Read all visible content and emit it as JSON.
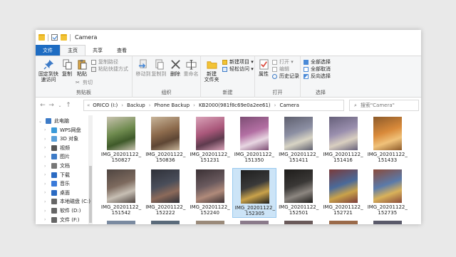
{
  "window": {
    "title": "Camera"
  },
  "tabs": [
    {
      "label": "文件",
      "kind": "file"
    },
    {
      "label": "主页",
      "kind": "active"
    },
    {
      "label": "共享",
      "kind": ""
    },
    {
      "label": "查看",
      "kind": ""
    }
  ],
  "ribbon": {
    "clipboard": {
      "label": "剪贴板",
      "pin": "固定到快\n速访问",
      "copy": "复制",
      "paste": "粘贴",
      "copy_path": "复制路径",
      "paste_shortcut": "粘贴快捷方式",
      "cut": "剪切"
    },
    "organize": {
      "label": "组织",
      "move_to": "移动到",
      "copy_to": "复制到",
      "delete": "删除",
      "rename": "重命名"
    },
    "new": {
      "label": "新建",
      "new_folder": "新建\n文件夹",
      "new_item": "新建项目 ▾",
      "easy_access": "轻松访问 ▾"
    },
    "open": {
      "label": "打开",
      "properties": "属性",
      "open": "打开 ▾",
      "edit": "编辑",
      "history": "历史记录"
    },
    "select": {
      "label": "选择",
      "select_all": "全部选择",
      "select_none": "全部取消",
      "invert": "反向选择"
    }
  },
  "address": {
    "crumbs": [
      "ORICO (I:)",
      "Backup",
      "Phone Backup",
      "KB2000(981f8c69e0a2ee61)",
      "Camera"
    ],
    "search_placeholder": "搜索\"Camera\""
  },
  "sidebar": [
    {
      "label": "此电脑",
      "icon": "pc-icon",
      "indent": 0
    },
    {
      "label": "WPS网盘",
      "icon": "cloud-icon",
      "indent": 1
    },
    {
      "label": "3D 对象",
      "icon": "cube-icon",
      "indent": 1
    },
    {
      "label": "视频",
      "icon": "video-icon",
      "indent": 1
    },
    {
      "label": "图片",
      "icon": "picture-icon",
      "indent": 1
    },
    {
      "label": "文档",
      "icon": "document-icon",
      "indent": 1
    },
    {
      "label": "下载",
      "icon": "download-icon",
      "indent": 1
    },
    {
      "label": "音乐",
      "icon": "music-icon",
      "indent": 1
    },
    {
      "label": "桌面",
      "icon": "desktop-icon",
      "indent": 1
    },
    {
      "label": "本地磁盘 (C:)",
      "icon": "drive-icon",
      "indent": 1
    },
    {
      "label": "软件 (D:)",
      "icon": "drive-icon",
      "indent": 1
    },
    {
      "label": "文件 (F:)",
      "icon": "drive-icon",
      "indent": 1
    }
  ],
  "files": [
    {
      "name": "IMG_20201122_\n150827",
      "selected": false,
      "colors": [
        "#6e8a4e",
        "#3f5a2a",
        "#c9c3b0"
      ]
    },
    {
      "name": "IMG_20201122_\n150836",
      "selected": false,
      "colors": [
        "#8c6a4c",
        "#5e4634",
        "#c8b59a"
      ]
    },
    {
      "name": "IMG_20201122_\n151231",
      "selected": false,
      "colors": [
        "#a9577a",
        "#5e3b4e",
        "#d9a2b8"
      ]
    },
    {
      "name": "IMG_20201122_\n151350",
      "selected": false,
      "colors": [
        "#b36fa3",
        "#e8d6e2",
        "#7d4d74"
      ]
    },
    {
      "name": "IMG_20201122_\n151411",
      "selected": false,
      "colors": [
        "#8c8fa3",
        "#d8d4c4",
        "#5e5f6e"
      ]
    },
    {
      "name": "IMG_20201122_\n151416",
      "selected": false,
      "colors": [
        "#9a8fae",
        "#d9cfc0",
        "#66607a"
      ]
    },
    {
      "name": "IMG_20201122_\n151433",
      "selected": false,
      "colors": [
        "#d98a3a",
        "#f0c27a",
        "#8c5a2a"
      ]
    },
    {
      "name": "IMG_20201122_\n151542",
      "selected": false,
      "colors": [
        "#7d6a5e",
        "#c7bfb4",
        "#4e4440"
      ]
    },
    {
      "name": "IMG_20201122_\n152222",
      "selected": false,
      "colors": [
        "#4a4e5a",
        "#8c6a5a",
        "#2e3038"
      ]
    },
    {
      "name": "IMG_20201122_\n152240",
      "selected": false,
      "colors": [
        "#6a5a5e",
        "#b08a7a",
        "#3a3034"
      ]
    },
    {
      "name": "IMG_20201122_\n152305",
      "selected": true,
      "colors": [
        "#3a3a3a",
        "#c9a24a",
        "#1e1e1e"
      ]
    },
    {
      "name": "IMG_20201122_\n152501",
      "selected": false,
      "colors": [
        "#3a3836",
        "#8c8680",
        "#1e1c1a"
      ]
    },
    {
      "name": "IMG_20201122_\n152721",
      "selected": false,
      "colors": [
        "#4a6a9a",
        "#c9a24a",
        "#7a3a3a"
      ]
    },
    {
      "name": "IMG_20201122_\n152735",
      "selected": false,
      "colors": [
        "#5a7aaa",
        "#d9b25a",
        "#8a4a3a"
      ]
    }
  ],
  "partial_row_hint": "",
  "colors": {
    "file_tab": "#1e6cc2",
    "selection": "#cce4f7"
  }
}
